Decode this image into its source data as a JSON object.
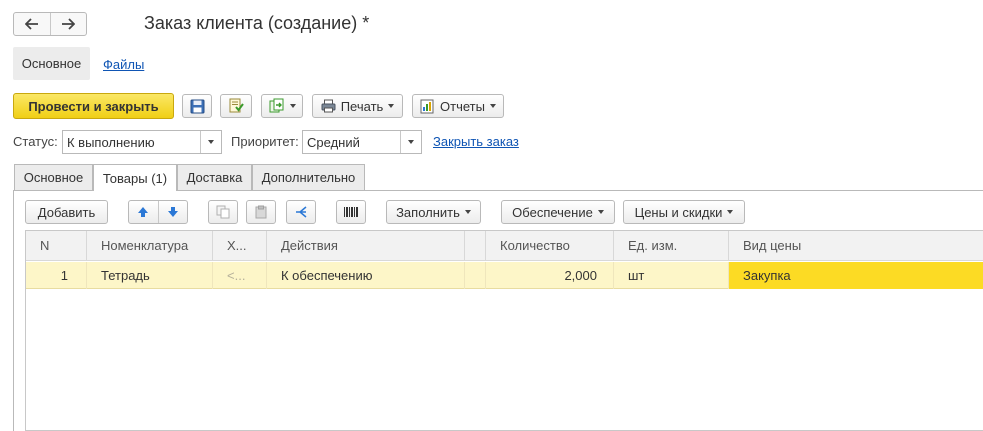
{
  "window": {
    "title": "Заказ клиента (создание) *"
  },
  "nav": {
    "back_icon": "arrow-left-icon",
    "forward_icon": "arrow-right-icon"
  },
  "top_tabs": [
    {
      "label": "Основное",
      "selected": true
    },
    {
      "label": "Файлы",
      "selected": false
    }
  ],
  "toolbar": {
    "post_close_label": "Провести и закрыть",
    "save_icon": "floppy-disk-icon",
    "post_icon": "post-document-icon",
    "create_based_icon": "create-based-on-icon",
    "print_label": "Печать",
    "reports_label": "Отчеты"
  },
  "status": {
    "status_label": "Статус:",
    "status_value": "К выполнению",
    "priority_label": "Приоритет:",
    "priority_value": "Средний",
    "close_order_link": "Закрыть заказ"
  },
  "page_tabs": [
    {
      "label": "Основное",
      "active": false
    },
    {
      "label": "Товары (1)",
      "active": true
    },
    {
      "label": "Доставка",
      "active": false
    },
    {
      "label": "Дополнительно",
      "active": false
    }
  ],
  "table_toolbar": {
    "add_label": "Добавить",
    "fill_label": "Заполнить",
    "supply_label": "Обеспечение",
    "prices_label": "Цены и скидки"
  },
  "table": {
    "columns": [
      "N",
      "Номенклатура",
      "Х...",
      "Действия",
      "",
      "Количество",
      "Ед. изм.",
      "Вид цены"
    ],
    "rows": [
      {
        "n": "1",
        "item": "Тетрадь",
        "char": "<...",
        "action": "К обеспечению",
        "qty": "2,000",
        "unit": "шт",
        "price_type": "Закупка"
      }
    ]
  },
  "colors": {
    "accent_yellow": "#f0cf15",
    "row_highlight": "#fdf6c8",
    "cell_highlight": "#fcdb24",
    "link_blue": "#0f55b4",
    "icon_blue": "#2b78d6",
    "icon_green": "#3a9a2c"
  }
}
